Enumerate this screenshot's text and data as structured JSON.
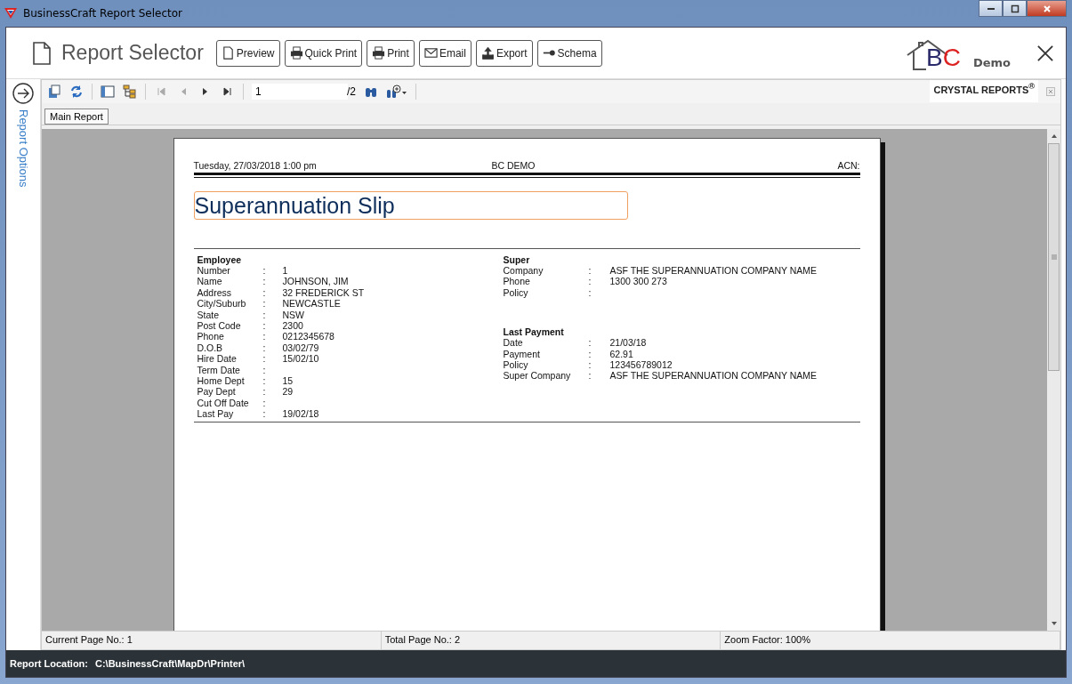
{
  "window": {
    "title": "BusinessCraft Report Selector"
  },
  "header": {
    "title": "Report Selector",
    "buttons": [
      {
        "label": "Preview",
        "kind": "doc"
      },
      {
        "label": "Quick Print",
        "kind": "print"
      },
      {
        "label": "Print",
        "kind": "print"
      },
      {
        "label": "Email",
        "kind": "mail"
      },
      {
        "label": "Export",
        "kind": "export"
      },
      {
        "label": "Schema",
        "kind": "key"
      }
    ],
    "logo": {
      "letters": [
        "B",
        "C"
      ],
      "caption": "Demo"
    }
  },
  "side_panel": {
    "label": "Report Options"
  },
  "toolbar": {
    "page_input": "1",
    "page_total": "/2",
    "brand": "CRYSTAL REPORTS",
    "brand_mark": "®"
  },
  "tabs": [
    {
      "label": "Main Report",
      "selected": true
    }
  ],
  "report": {
    "date": "Tuesday, 27/03/2018  1:00 pm",
    "company": "BC DEMO",
    "acn": "ACN:",
    "title": "Superannuation Slip",
    "employee": {
      "heading": "Employee",
      "rows": [
        {
          "label": "Number",
          "value": "1"
        },
        {
          "label": "Name",
          "value": "JOHNSON, JIM"
        },
        {
          "label": "Address",
          "value": "32 FREDERICK ST"
        },
        {
          "label": "City/Suburb",
          "value": "NEWCASTLE"
        },
        {
          "label": "State",
          "value": "NSW"
        },
        {
          "label": "Post Code",
          "value": "2300"
        },
        {
          "label": "Phone",
          "value": "0212345678"
        },
        {
          "label": "D.O.B",
          "value": "03/02/79"
        },
        {
          "label": "Hire Date",
          "value": "15/02/10"
        },
        {
          "label": "Term Date",
          "value": ""
        },
        {
          "label": "Home Dept",
          "value": "15"
        },
        {
          "label": "Pay Dept",
          "value": "29"
        },
        {
          "label": "Cut Off Date",
          "value": ""
        },
        {
          "label": "Last Pay",
          "value": "19/02/18"
        }
      ]
    },
    "sections": [
      {
        "heading": "Super",
        "rows": [
          {
            "label": "Company",
            "value": "ASF THE SUPERANNUATION COMPANY NAME"
          },
          {
            "label": "Phone",
            "value": "1300 300 273"
          },
          {
            "label": "Policy",
            "value": ""
          }
        ]
      },
      {
        "heading": "Last Payment",
        "rows": [
          {
            "label": "Date",
            "value": "21/03/18"
          },
          {
            "label": "Payment",
            "value": "62.91"
          },
          {
            "label": "Policy",
            "value": "123456789012"
          },
          {
            "label": "Super Company",
            "value": "ASF THE SUPERANNUATION COMPANY NAME"
          }
        ]
      }
    ],
    "colon": ":"
  },
  "status_bar": [
    "Current Page No.: 1",
    "Total Page No.: 2",
    "Zoom Factor: 100%"
  ],
  "footer": {
    "label": "Report Location:",
    "value": "C:\\BusinessCraft\\MapDr\\Printer\\"
  }
}
